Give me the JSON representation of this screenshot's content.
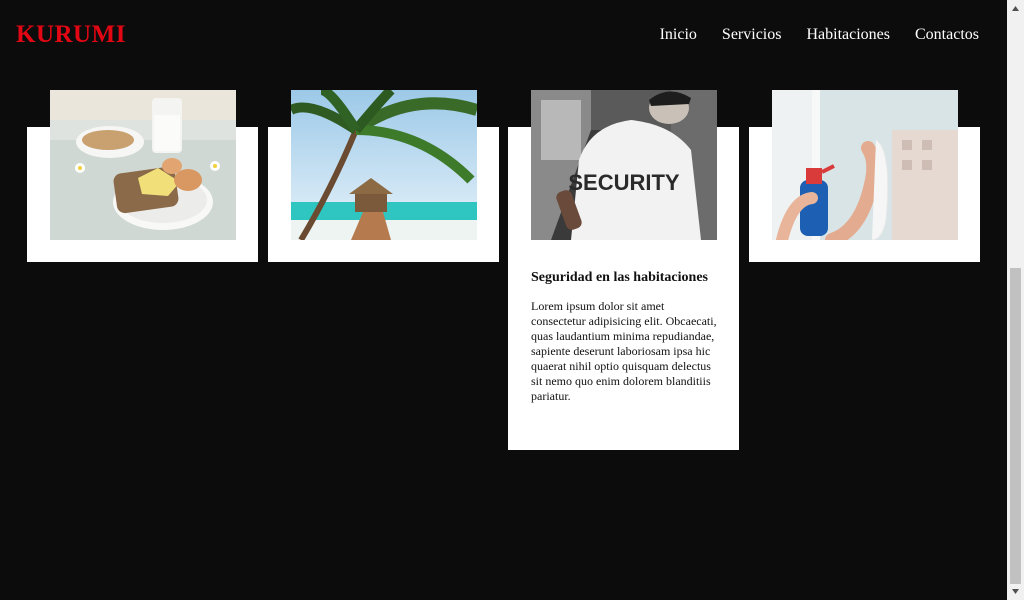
{
  "brand": {
    "name": "KURUMI",
    "color": "#e30613"
  },
  "nav": {
    "items": [
      {
        "label": "Inicio"
      },
      {
        "label": "Servicios"
      },
      {
        "label": "Habitaciones"
      },
      {
        "label": "Contactos"
      }
    ]
  },
  "cards": [
    {
      "image": "breakfast-photo"
    },
    {
      "image": "beach-pier-photo"
    },
    {
      "image": "security-guard-photo",
      "title": "Seguridad en las habitaciones",
      "text": "Lorem ipsum dolor sit amet consectetur adipisicing elit. Obcaecati, quas laudantium minima repudiandae, sapiente deserunt laboriosam ipsa hic quaerat nihil optio quisquam delectus sit nemo quo enim dolorem blanditiis pariatur.",
      "image_text": "SECURITY"
    },
    {
      "image": "cleaning-photo"
    }
  ],
  "colors": {
    "background": "#0c0c0c",
    "card": "#ffffff",
    "nav_text": "#ffffff"
  }
}
